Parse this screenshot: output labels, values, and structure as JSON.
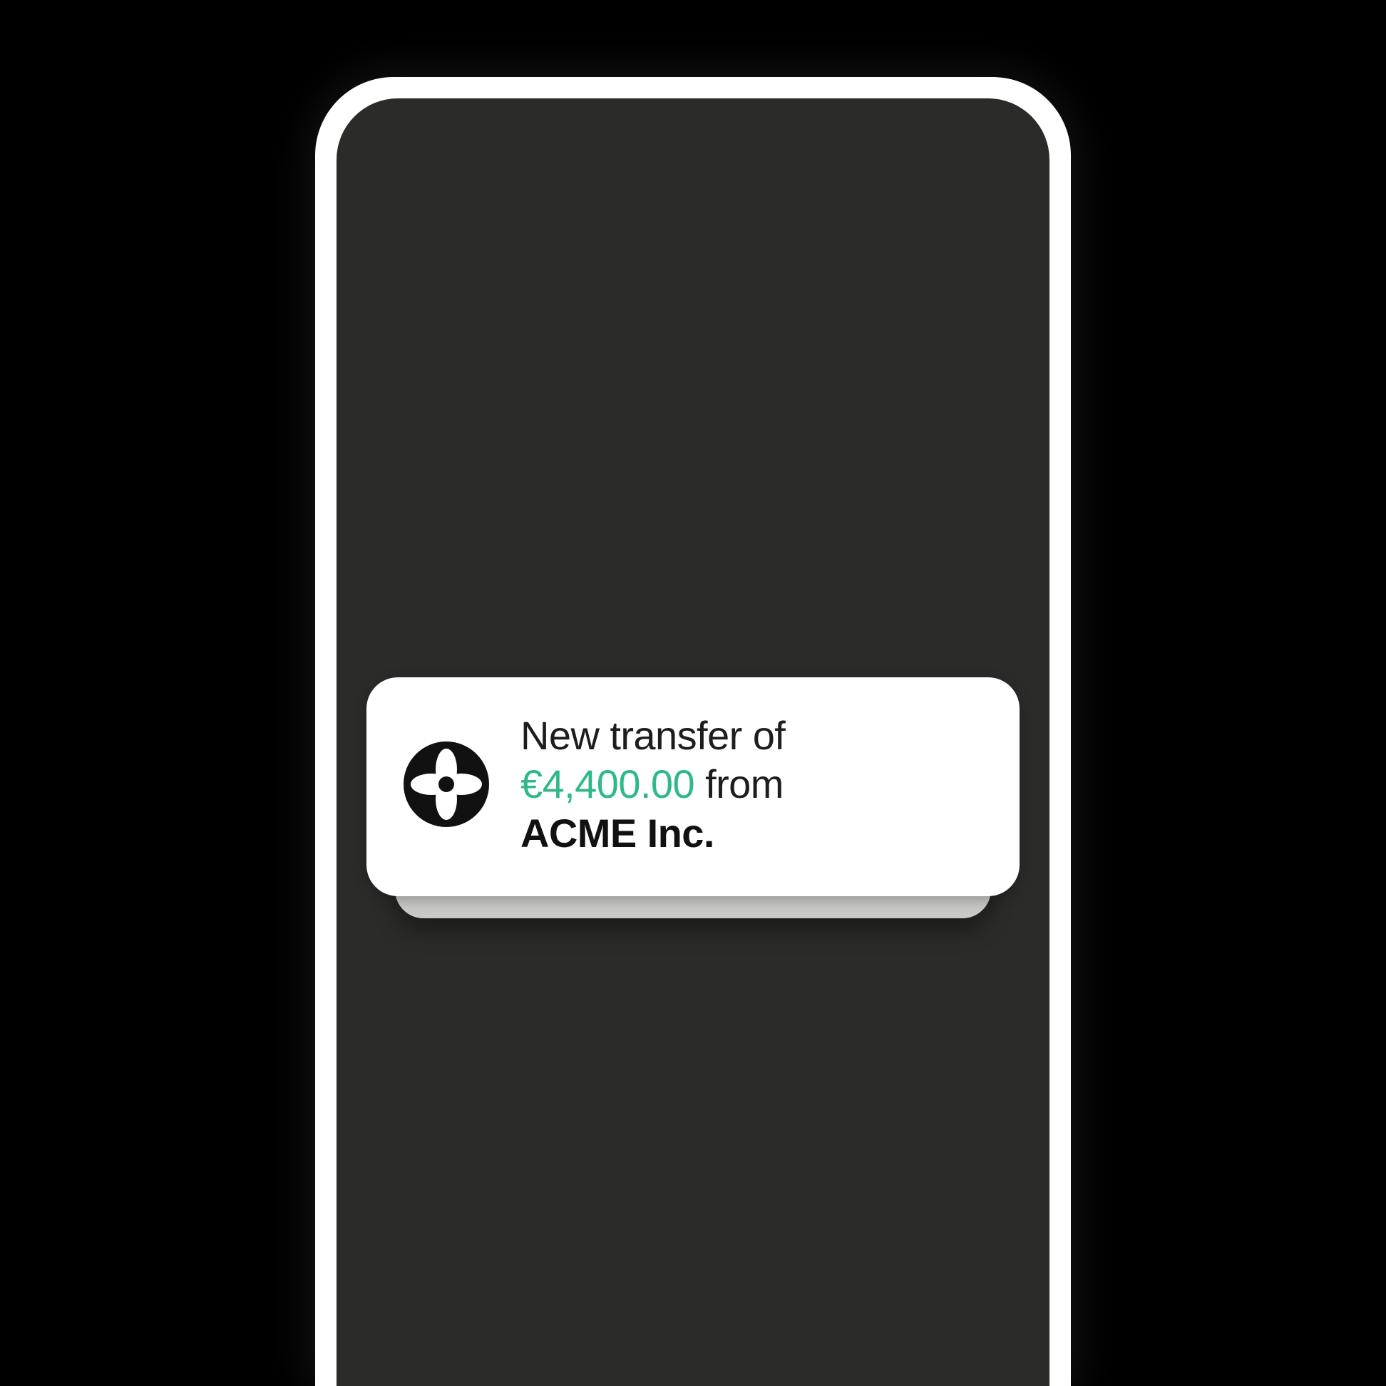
{
  "notification": {
    "prefix": "New transfer of",
    "amount": "€4,400.00",
    "middle": "from",
    "sender": "ACME Inc.",
    "icon_name": "qonto-flower-icon"
  },
  "colors": {
    "amount": "#2fb98a",
    "screen_bg": "#2b2b2a"
  }
}
